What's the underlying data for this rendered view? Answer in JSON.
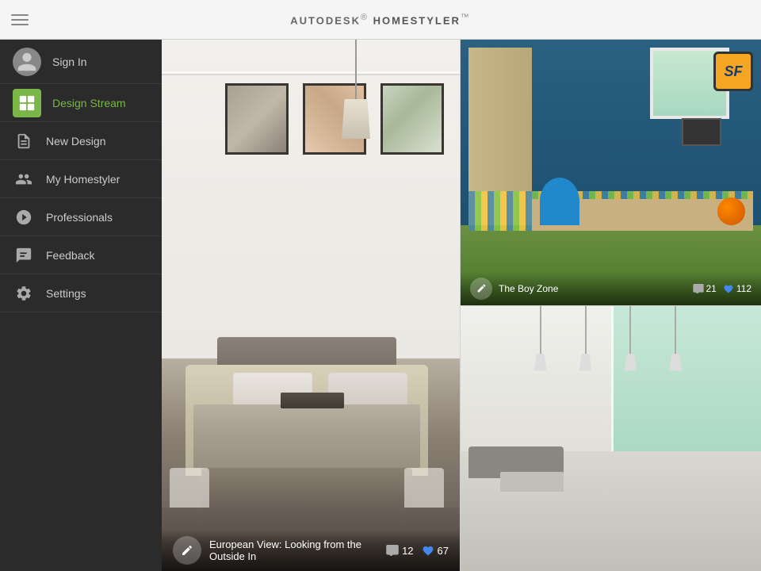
{
  "header": {
    "title_prefix": "AUTODESK",
    "title_superscript": "®",
    "title_brand": "HOMESTYLER",
    "title_tm": "™"
  },
  "sidebar": {
    "sign_in_label": "Sign In",
    "items": [
      {
        "id": "design-stream",
        "label": "Design Stream",
        "active": true
      },
      {
        "id": "new-design",
        "label": "New Design",
        "active": false
      },
      {
        "id": "my-homestyler",
        "label": "My Homestyler",
        "active": false
      },
      {
        "id": "professionals",
        "label": "Professionals",
        "active": false
      },
      {
        "id": "feedback",
        "label": "Feedback",
        "active": false
      },
      {
        "id": "settings",
        "label": "Settings",
        "active": false
      }
    ]
  },
  "left_panel": {
    "title": "European View: Looking from the Outside In",
    "comment_count": "12",
    "like_count": "67"
  },
  "right_top_panel": {
    "title": "The Boy Zone",
    "comment_count": "21",
    "like_count": "112"
  },
  "right_bottom_panel": {
    "title": "",
    "comment_count": "",
    "like_count": ""
  },
  "icons": {
    "hamburger": "☰",
    "comment": "💬",
    "heart": "♥",
    "edit": "✏",
    "pencil_ruler": "⊹"
  },
  "colors": {
    "accent_green": "#7ab648",
    "sidebar_bg": "#2b2b2b",
    "sidebar_text": "#cccccc",
    "header_bg": "#f5f5f5"
  }
}
